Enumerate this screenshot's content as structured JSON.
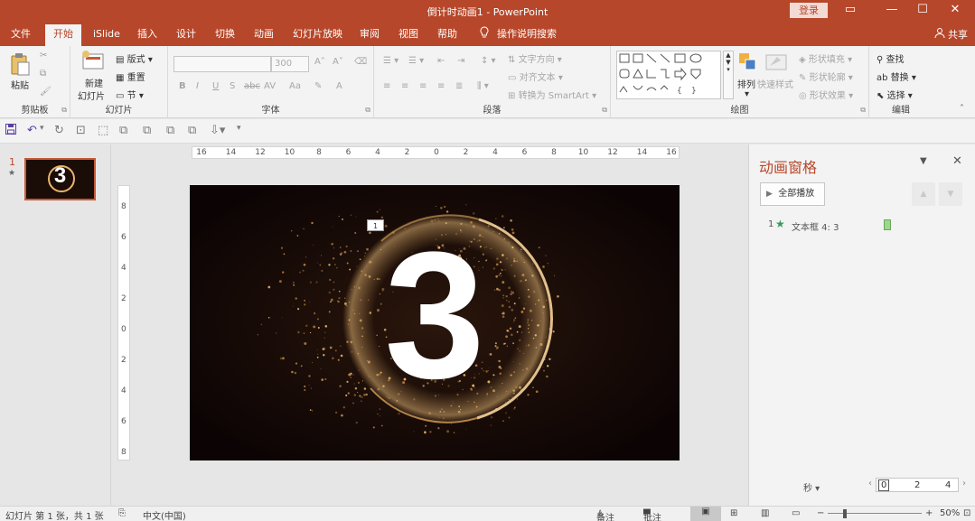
{
  "titlebar": {
    "title": "倒计时动画1  -  PowerPoint",
    "login": "登录",
    "window_buttons": [
      "▭",
      "—",
      "☐",
      "✕"
    ]
  },
  "tabs": [
    "文件",
    "开始",
    "iSlide",
    "插入",
    "设计",
    "切换",
    "动画",
    "幻灯片放映",
    "审阅",
    "视图",
    "帮助",
    "操作说明搜索"
  ],
  "active_tab": "开始",
  "share": "共享",
  "ribbon": {
    "clipboard": {
      "label": "剪贴板",
      "paste": "粘贴"
    },
    "slides": {
      "label": "幻灯片",
      "new_slide_1": "新建",
      "new_slide_2": "幻灯片",
      "layout": "版式",
      "reset": "重置",
      "section": "节"
    },
    "font": {
      "label": "字体",
      "font_name": "",
      "font_size": "300",
      "bold": "B",
      "italic": "I",
      "underline": "U",
      "shadow": "S",
      "strike": "abc",
      "spacing": "AV",
      "case": "Aa",
      "color": "A"
    },
    "paragraph": {
      "label": "段落",
      "text_direction": "文字方向",
      "align_text": "对齐文本",
      "smartart": "转换为 SmartArt"
    },
    "drawing": {
      "label": "绘图",
      "arrange": "排列",
      "quick_styles": "快速样式",
      "shape_fill": "形状填充",
      "shape_outline": "形状轮廓",
      "shape_effects": "形状效果"
    },
    "editing": {
      "label": "编辑",
      "find": "查找",
      "replace": "替换",
      "select": "选择"
    }
  },
  "thumbnail": {
    "number": "1",
    "star": "★",
    "text": "3"
  },
  "ruler_h_labels": [
    "16",
    "14",
    "12",
    "10",
    "8",
    "6",
    "4",
    "2",
    "0",
    "2",
    "4",
    "6",
    "8",
    "10",
    "12",
    "14",
    "16"
  ],
  "ruler_v_labels": [
    "8",
    "6",
    "4",
    "2",
    "0",
    "2",
    "4",
    "6",
    "8"
  ],
  "slide": {
    "big_number": "3",
    "anim_tag": "1"
  },
  "animation_pane": {
    "title": "动画窗格",
    "play_all": "全部播放",
    "item_number": "1",
    "item_label": "文本框 4: 3",
    "seconds": "秒",
    "timeline": [
      "0",
      "2",
      "4"
    ]
  },
  "status": {
    "slide_info": "幻灯片 第 1 张，共 1 张",
    "language": "中文(中国)",
    "notes": "备注",
    "comments": "批注",
    "zoom": "50%"
  },
  "colors": {
    "accent": "#b7472a",
    "slide_bg": "#140808",
    "gold": "#d9a45a"
  }
}
